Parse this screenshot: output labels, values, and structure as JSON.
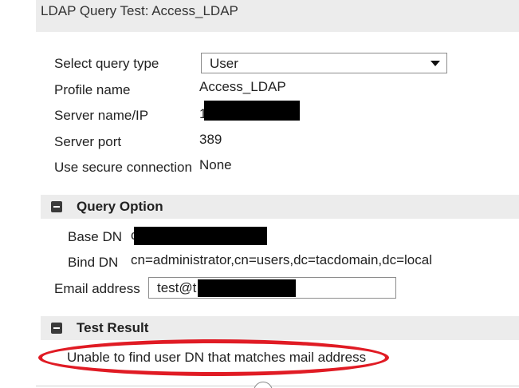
{
  "dialog": {
    "title": "LDAP Query Test: Access_LDAP"
  },
  "fields": {
    "query_type": {
      "label": "Select query type",
      "value": "User"
    },
    "profile_name": {
      "label": "Profile name",
      "value": "Access_LDAP"
    },
    "server_name": {
      "label": "Server name/IP",
      "value": "1"
    },
    "server_port": {
      "label": "Server port",
      "value": "389"
    },
    "secure_connection": {
      "label": "Use secure connection",
      "value": "None"
    }
  },
  "query_option": {
    "title": "Query Option",
    "base_dn": {
      "label": "Base DN",
      "value": "c"
    },
    "bind_dn": {
      "label": "Bind DN",
      "value": "cn=administrator,cn=users,dc=tacdomain,dc=local"
    },
    "email": {
      "label": "Email address",
      "value": "test@t"
    }
  },
  "test_result": {
    "title": "Test Result",
    "message": "Unable to find user DN that matches mail address"
  },
  "colors": {
    "highlight_ellipse": "#e01b24",
    "section_bg": "#ececec",
    "redaction": "#000000"
  },
  "icons": {
    "section_toggle": "collapse-minus-icon",
    "dropdown": "chevron-down-icon"
  }
}
